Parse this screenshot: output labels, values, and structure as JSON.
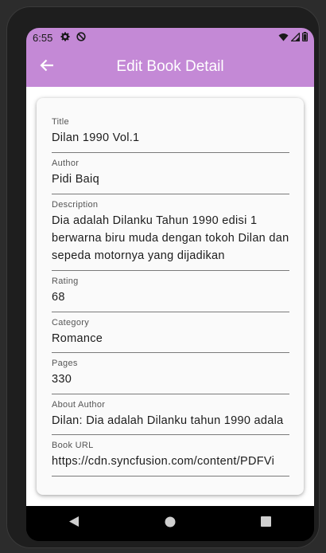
{
  "status_bar": {
    "time": "6:55",
    "left_icons": [
      "gear-icon",
      "no-disturb-icon"
    ],
    "right_icons": [
      "wifi-icon",
      "signal-icon",
      "battery-icon"
    ]
  },
  "app_bar": {
    "title": "Edit Book Detail",
    "back_icon": "arrow-left-icon",
    "color": "#c489d6"
  },
  "form": {
    "fields": [
      {
        "label": "Title",
        "value": "Dilan 1990 Vol.1"
      },
      {
        "label": "Author",
        "value": "Pidi Baiq"
      },
      {
        "label": "Description",
        "value": "Dia adalah Dilanku Tahun 1990 edisi 1 berwarna biru muda dengan tokoh Dilan dan sepeda motornya yang dijadikan"
      },
      {
        "label": "Rating",
        "value": "68"
      },
      {
        "label": "Category",
        "value": "Romance"
      },
      {
        "label": "Pages",
        "value": "330"
      },
      {
        "label": "About Author",
        "value": "Dilan: Dia adalah Dilanku tahun 1990 adala"
      },
      {
        "label": "Book URL",
        "value": "https://cdn.syncfusion.com/content/PDFVi"
      }
    ]
  },
  "nav_bar": {
    "buttons": [
      "back-triangle-icon",
      "home-circle-icon",
      "recents-square-icon"
    ]
  }
}
